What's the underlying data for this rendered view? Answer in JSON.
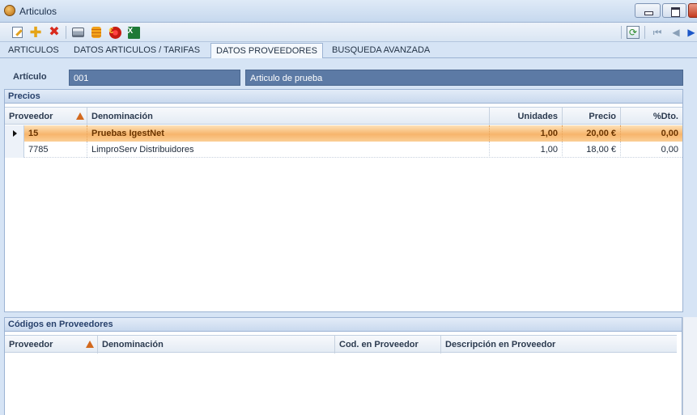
{
  "window": {
    "title": "Articulos"
  },
  "toolbar": {
    "icons": [
      "edit-icon",
      "add-icon",
      "delete-icon",
      "print-icon",
      "database-icon",
      "euro-icon",
      "excel-icon",
      "refresh-icon",
      "first-record-icon",
      "previous-record-icon",
      "next-record-icon"
    ],
    "add_glyph": "✚",
    "delete_glyph": "✖",
    "euro_glyph": "€",
    "excel_glyph": "X"
  },
  "tabs": [
    {
      "label": "ARTICULOS",
      "active": false
    },
    {
      "label": "DATOS ARTICULOS / TARIFAS",
      "active": false
    },
    {
      "label": "DATOS PROVEEDORES",
      "active": true
    },
    {
      "label": "BUSQUEDA AVANZADA",
      "active": false
    }
  ],
  "articulo": {
    "label": "Artículo",
    "code": "001",
    "description": "Articulo de prueba"
  },
  "precios": {
    "title": "Precios",
    "columns": [
      "Proveedor",
      "Denominación",
      "Unidades",
      "Precio",
      "%Dto."
    ],
    "rows": [
      {
        "proveedor": "15",
        "denominacion": "Pruebas IgestNet",
        "unidades": "1,00",
        "precio": "20,00 €",
        "dto": "0,00",
        "selected": true
      },
      {
        "proveedor": "7785",
        "denominacion": "LimproServ Distribuidores",
        "unidades": "1,00",
        "precio": "18,00 €",
        "dto": "0,00",
        "selected": false
      }
    ]
  },
  "codigos": {
    "title": "Códigos en Proveedores",
    "columns": [
      "Proveedor",
      "Denominación",
      "Cod. en Proveedor",
      "Descripción en Proveedor"
    ]
  },
  "colors": {
    "accent": "#5c7aa5",
    "selected_row": "#f7b56c",
    "sort_arrow": "#d2691e",
    "close_button": "#c33b1f"
  }
}
